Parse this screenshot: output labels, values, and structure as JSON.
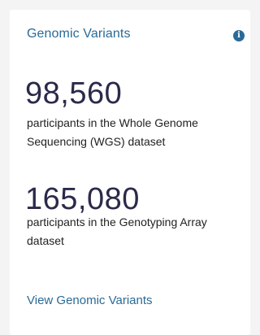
{
  "card": {
    "title": "Genomic Variants",
    "info_icon": "info-icon",
    "stats": [
      {
        "value": "98,560",
        "description": "participants in the Whole Genome Sequencing (WGS) dataset"
      },
      {
        "value": "165,080",
        "description": "participants in the Genotyping Array dataset"
      }
    ],
    "link_label": "View Genomic Variants"
  },
  "colors": {
    "accent": "#2a6a96",
    "stat_value": "#2a2a4a",
    "background": "#f4f4f5",
    "card": "#ffffff"
  }
}
